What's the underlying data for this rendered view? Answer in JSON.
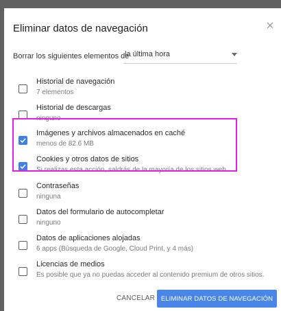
{
  "dialog": {
    "title": "Eliminar datos de navegación",
    "close_icon": "close-icon"
  },
  "time_range": {
    "label": "Borrar los siguientes elementos de",
    "selected": "la última hora"
  },
  "items": [
    {
      "title": "Historial de navegación",
      "subtitle": "7 elementos",
      "checked": false
    },
    {
      "title": "Historial de descargas",
      "subtitle": "ninguno",
      "checked": false
    },
    {
      "title": "Imágenes y archivos almacenados en caché",
      "subtitle": "menos de 82.6 MB",
      "checked": true
    },
    {
      "title": "Cookies y otros datos de sitios",
      "subtitle": "Si realizas esta acción, saldrás de la mayoría de los sitios web.",
      "checked": true
    },
    {
      "title": "Contraseñas",
      "subtitle": "ninguna",
      "checked": false
    },
    {
      "title": "Datos del formulario de autocompletar",
      "subtitle": "ninguno",
      "checked": false
    },
    {
      "title": "Datos de aplicaciones alojadas",
      "subtitle": "6 apps (Búsqueda de Google, Cloud Print, y 4 más)",
      "checked": false
    },
    {
      "title": "Licencias de medios",
      "subtitle": "Es posible que ya no puedas acceder al contenido premium de otros sitios.",
      "checked": false
    }
  ],
  "footer": {
    "cancel_label": "CANCELAR",
    "confirm_label": "ELIMINAR DATOS DE NAVEGACIÓN"
  },
  "colors": {
    "accent": "#4a86e8",
    "highlight": "#e61ee6"
  }
}
